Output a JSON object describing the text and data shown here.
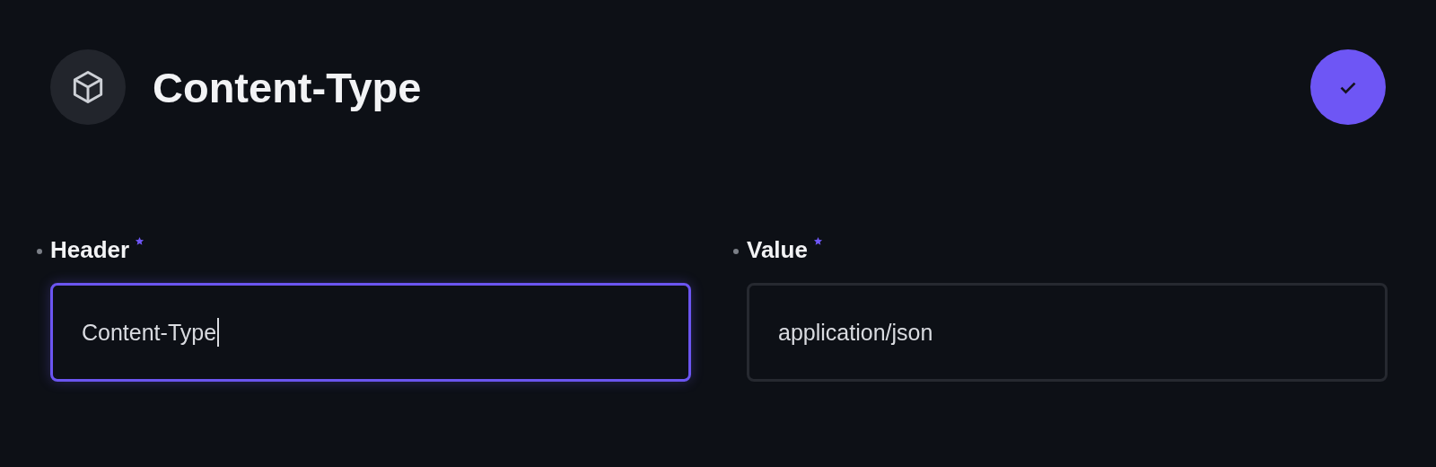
{
  "header": {
    "title": "Content-Type",
    "confirmed": true
  },
  "fields": [
    {
      "label": "Header",
      "required": true,
      "value": "Content-Type",
      "focused": true
    },
    {
      "label": "Value",
      "required": true,
      "value": "application/json",
      "focused": false
    }
  ]
}
